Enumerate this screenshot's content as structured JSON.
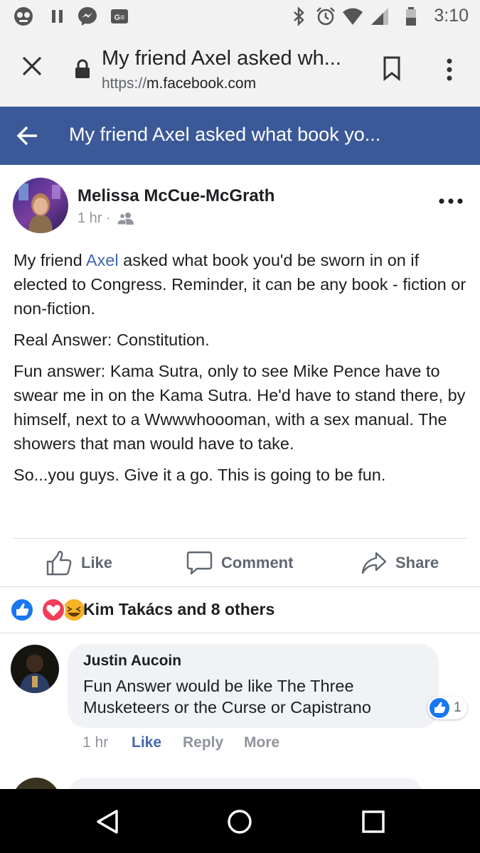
{
  "status_bar": {
    "time": "3:10",
    "left_icons": [
      "photo-app-icon",
      "pause-icon",
      "messenger-icon",
      "news-app-icon"
    ],
    "right_icons": [
      "bluetooth-icon",
      "alarm-icon",
      "wifi-icon",
      "cell-signal-icon",
      "battery-icon"
    ]
  },
  "browser": {
    "page_title": "My friend Axel asked wh...",
    "url_scheme": "https://",
    "url_host": "m.facebook.com"
  },
  "fb_header": {
    "title": "My friend Axel asked what book yo..."
  },
  "post": {
    "author": "Melissa McCue-McGrath",
    "time": "1 hr",
    "separator": "·",
    "audience_icon": "friends-icon",
    "paragraph_1_pre": "My friend ",
    "paragraph_1_link": "Axel",
    "paragraph_1_post": " asked what book you'd be sworn in on if elected to Congress. Reminder, it can be any book - fiction or non-fiction.",
    "paragraph_2": "Real Answer: Constitution.",
    "paragraph_3": "Fun answer: Kama Sutra, only to see Mike Pence have to swear me in on the Kama Sutra. He'd have to stand there, by himself, next to a Wwwwhoooman, with a sex manual. The showers that man would have to take.",
    "paragraph_4": "So...you guys. Give it a go. This is going to be fun."
  },
  "actions": {
    "like": "Like",
    "comment": "Comment",
    "share": "Share"
  },
  "reactions": {
    "types": [
      "like",
      "love",
      "haha"
    ],
    "summary": "Kim Takács and 8 others"
  },
  "comment": {
    "author": "Justin Aucoin",
    "text": "Fun Answer would be like The Three Musketeers or the Curse or Capistrano",
    "reaction_count": "1",
    "time": "1 hr",
    "like": "Like",
    "reply": "Reply",
    "more": "More"
  },
  "colors": {
    "facebook_blue": "#3b5998",
    "link_blue": "#4267b2",
    "love_red": "#f33e58",
    "haha_yellow": "#f7b125"
  }
}
